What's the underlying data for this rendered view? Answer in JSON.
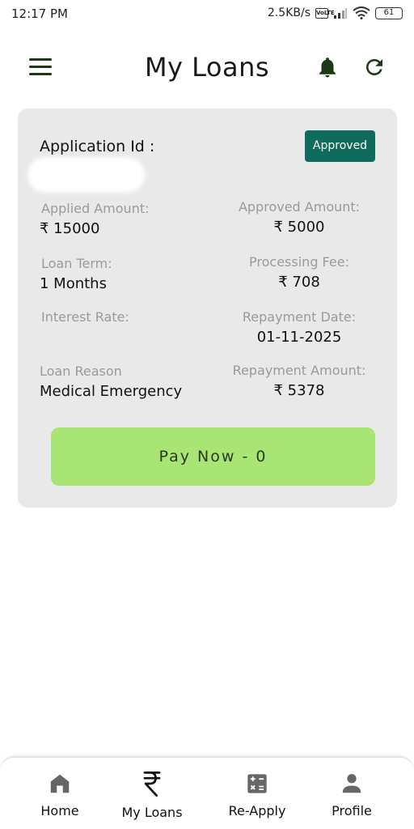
{
  "status_bar": {
    "time": "12:17 PM",
    "network_speed": "2.5KB/s",
    "volte": "Vo LTE",
    "battery": "61"
  },
  "header": {
    "title": "My Loans",
    "icons": [
      "menu-icon",
      "bell-icon",
      "refresh-icon"
    ]
  },
  "loan_card": {
    "application_id_label": "Application Id :",
    "status": "Approved",
    "applied_amount_label": "Applied Amount:",
    "applied_amount": "₹ 15000",
    "approved_amount_label": "Approved Amount:",
    "approved_amount": "₹ 5000",
    "loan_term_label": "Loan Term:",
    "loan_term": "1 Months",
    "processing_fee_label": "Processing Fee:",
    "processing_fee": "₹ 708",
    "interest_rate_label": "Interest Rate:",
    "interest_rate": "",
    "repayment_date_label": "Repayment Date:",
    "repayment_date": "01-11-2025",
    "loan_reason_label": "Loan Reason",
    "loan_reason": "Medical Emergency",
    "repayment_amount_label": "Repayment Amount:",
    "repayment_amount": "₹ 5378",
    "pay_button_label": "Pay Now - 0"
  },
  "bottom_nav": {
    "items": [
      {
        "label": "Home",
        "icon": "home-icon"
      },
      {
        "label": "My Loans",
        "icon": "rupee-icon"
      },
      {
        "label": "Re-Apply",
        "icon": "calculator-icon"
      },
      {
        "label": "Profile",
        "icon": "person-icon"
      }
    ]
  },
  "colors": {
    "accent": "#1b3a12",
    "badge": "#0f6b5c",
    "pay_button": "#a8e575",
    "card_bg": "#e9e9e9"
  }
}
